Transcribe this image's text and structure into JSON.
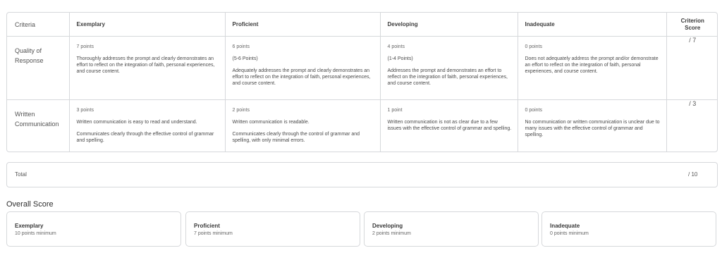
{
  "rubric": {
    "headers": {
      "criteria": "Criteria",
      "exemplary": "Exemplary",
      "proficient": "Proficient",
      "developing": "Developing",
      "inadequate": "Inadequate",
      "score_line1": "Criterion",
      "score_line2": "Score"
    },
    "rows": [
      {
        "criterion_line1": "Quality of",
        "criterion_line2": "Response",
        "exemplary": {
          "points": "7 points",
          "text": "Thoroughly addresses the prompt and clearly demonstrates an effort to reflect on the integration of faith, personal experiences, and course content."
        },
        "proficient": {
          "points": "6 points",
          "range": "(5-6 Points)",
          "text": "Adequately addresses the prompt and clearly demonstrates an effort to reflect on the integration of faith, personal experiences, and course content."
        },
        "developing": {
          "points": "4 points",
          "range": "(1-4 Points)",
          "text": "Addresses the prompt and demonstrates an effort to reflect on the integration of faith, personal experiences, and course content."
        },
        "inadequate": {
          "points": "0 points",
          "text": "Does not adequately address the prompt and/or demonstrate an effort to reflect on the integration of faith, personal experiences, and course content."
        },
        "score": "/ 7"
      },
      {
        "criterion_line1": "Written",
        "criterion_line2": "Communication",
        "exemplary": {
          "points": "3 points",
          "text1": "Written communication is easy to read and understand.",
          "text2": "Communicates clearly through the effective control of grammar and spelling."
        },
        "proficient": {
          "points": "2 points",
          "text1": "Written communication is readable.",
          "text2": "Communicates clearly through the control of grammar and spelling, with only minimal errors."
        },
        "developing": {
          "points": "1 point",
          "text": "Written communication is not as clear due to a few issues with the effective control of grammar and spelling."
        },
        "inadequate": {
          "points": "0 points",
          "text": "No communication or written communication is unclear due to many issues with the effective control of grammar and spelling."
        },
        "score": "/ 3"
      }
    ]
  },
  "total": {
    "label": "Total",
    "value": "/ 10"
  },
  "overall": {
    "title": "Overall Score",
    "levels": [
      {
        "name": "Exemplary",
        "minimum": "10 points minimum"
      },
      {
        "name": "Proficient",
        "minimum": "7 points minimum"
      },
      {
        "name": "Developing",
        "minimum": "2 points minimum"
      },
      {
        "name": "Inadequate",
        "minimum": "0 points minimum"
      }
    ]
  }
}
